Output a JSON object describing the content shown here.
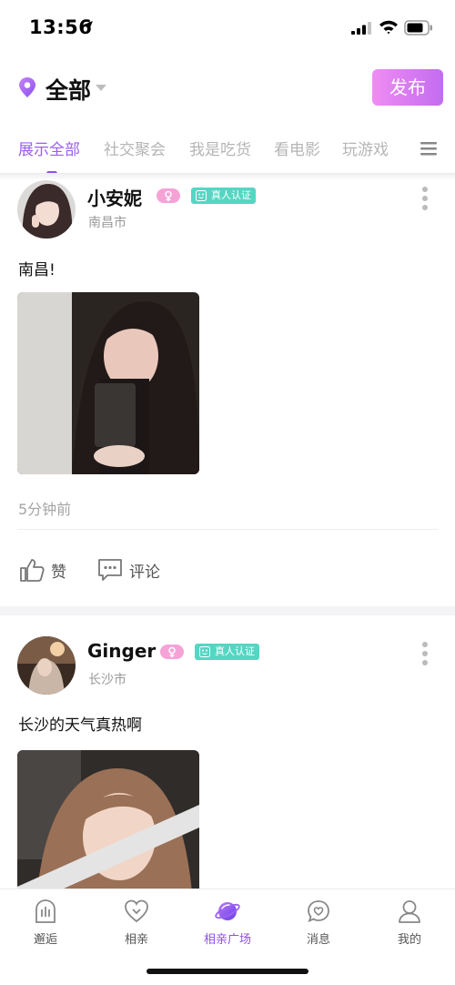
{
  "status_bar": {
    "time": "13:56"
  },
  "header": {
    "city": "全部",
    "publish_label": "发布"
  },
  "tabs": [
    {
      "label": "展示全部",
      "active": true
    },
    {
      "label": "社交聚会",
      "active": false
    },
    {
      "label": "我是吃货",
      "active": false
    },
    {
      "label": "看电影",
      "active": false
    },
    {
      "label": "玩游戏",
      "active": false
    }
  ],
  "verify_label": "真人认证",
  "posts": [
    {
      "name": "小安妮",
      "city": "南昌市",
      "text": "南昌!",
      "time": "5分钟前",
      "like_label": "赞",
      "comment_label": "评论"
    },
    {
      "name": "Ginger",
      "city": "长沙市",
      "text": "长沙的天气真热啊"
    }
  ],
  "bottom_nav": [
    {
      "label": "邂逅",
      "icon": "encounter-icon"
    },
    {
      "label": "相亲",
      "icon": "heart-icon"
    },
    {
      "label": "相亲广场",
      "icon": "planet-icon",
      "active": true
    },
    {
      "label": "消息",
      "icon": "message-icon"
    },
    {
      "label": "我的",
      "icon": "profile-icon"
    }
  ],
  "colors": {
    "accent": "#8d4ff0",
    "publish_gradient_start": "#f08cf2",
    "publish_gradient_end": "#c26cf0",
    "verify": "#55d6c3",
    "gender": "#f5a3d7"
  }
}
